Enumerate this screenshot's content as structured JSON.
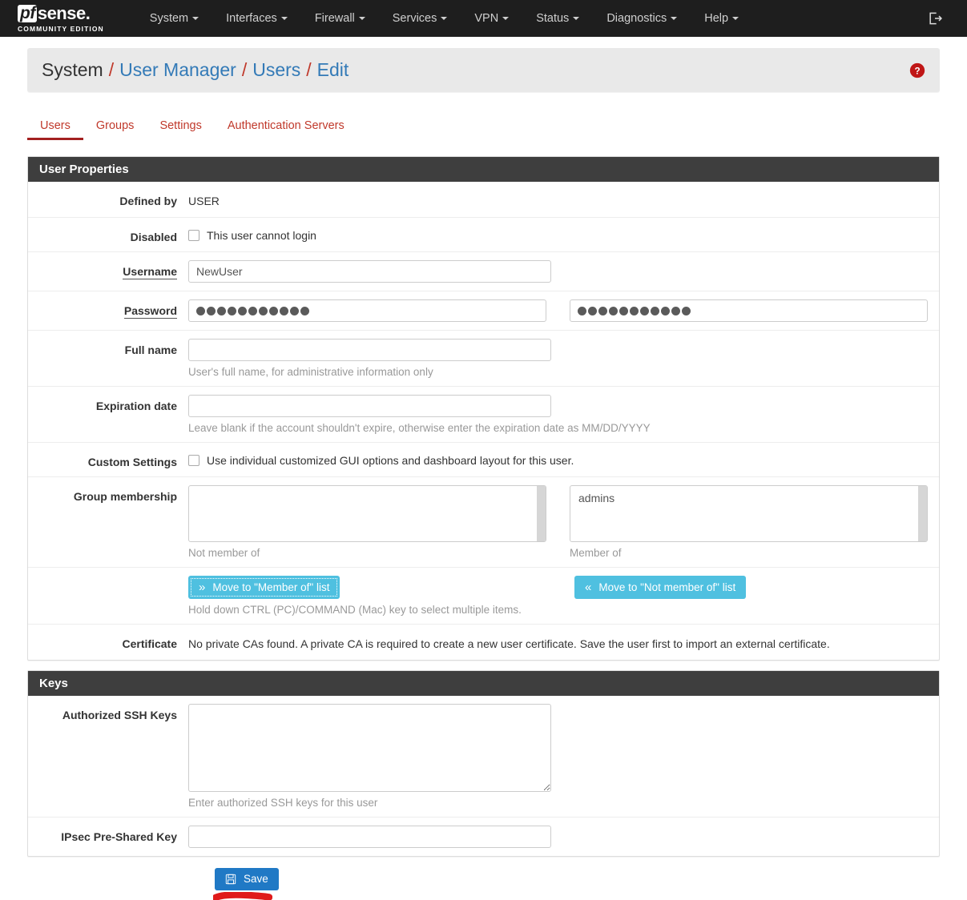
{
  "brand": {
    "name_pf": "pf",
    "name_sense": "sense",
    "subtitle": "COMMUNITY EDITION"
  },
  "navbar": {
    "items": [
      {
        "label": "System",
        "has_caret": true
      },
      {
        "label": "Interfaces",
        "has_caret": true
      },
      {
        "label": "Firewall",
        "has_caret": true
      },
      {
        "label": "Services",
        "has_caret": true
      },
      {
        "label": "VPN",
        "has_caret": true
      },
      {
        "label": "Status",
        "has_caret": true
      },
      {
        "label": "Diagnostics",
        "has_caret": true
      },
      {
        "label": "Help",
        "has_caret": true
      }
    ],
    "logout_icon": "logout-icon"
  },
  "breadcrumb": {
    "parts": [
      "System",
      "User Manager",
      "Users",
      "Edit"
    ],
    "separator": "/",
    "help_icon": "help-circle-icon"
  },
  "tabs": [
    {
      "label": "Users",
      "active": true
    },
    {
      "label": "Groups",
      "active": false
    },
    {
      "label": "Settings",
      "active": false
    },
    {
      "label": "Authentication Servers",
      "active": false
    }
  ],
  "user_properties": {
    "heading": "User Properties",
    "defined_by": {
      "label": "Defined by",
      "value": "USER"
    },
    "disabled": {
      "label": "Disabled",
      "checkbox_label": "This user cannot login",
      "checked": false
    },
    "username": {
      "label": "Username",
      "value": "NewUser",
      "placeholder": "",
      "required": true
    },
    "password": {
      "label": "Password",
      "required": true,
      "value_masked": "•••••••••••",
      "confirm_masked": "•••••••••••",
      "dot_count": 11
    },
    "full_name": {
      "label": "Full name",
      "value": "",
      "placeholder": "",
      "help": "User's full name, for administrative information only"
    },
    "expiration_date": {
      "label": "Expiration date",
      "value": "",
      "placeholder": "",
      "help": "Leave blank if the account shouldn't expire, otherwise enter the expiration date as MM/DD/YYYY"
    },
    "custom_settings": {
      "label": "Custom Settings",
      "checkbox_label": "Use individual customized GUI options and dashboard layout for this user.",
      "checked": false
    },
    "group_membership": {
      "label": "Group membership",
      "not_member_of": {
        "caption": "Not member of",
        "options": []
      },
      "member_of": {
        "caption": "Member of",
        "options": [
          "admins"
        ]
      },
      "move_to_member_button": "Move to \"Member of\" list",
      "move_to_not_member_button": "Move to \"Not member of\" list",
      "help": "Hold down CTRL (PC)/COMMAND (Mac) key to select multiple items."
    },
    "certificate": {
      "label": "Certificate",
      "value": "No private CAs found. A private CA is required to create a new user certificate. Save the user first to import an external certificate."
    }
  },
  "keys": {
    "heading": "Keys",
    "authorized_ssh_keys": {
      "label": "Authorized SSH Keys",
      "value": "",
      "placeholder": "",
      "help": "Enter authorized SSH keys for this user"
    },
    "ipsec_psk": {
      "label": "IPsec Pre-Shared Key",
      "value": "",
      "placeholder": ""
    }
  },
  "actions": {
    "save_label": "Save",
    "save_icon": "floppy-disk-icon"
  },
  "colors": {
    "navbar_bg": "#1e1e1e",
    "panel_heading_bg": "#3e3e3e",
    "tab_active": "#a32020",
    "tab_text": "#c0392b",
    "link": "#337ab7",
    "btn_info": "#4fc0e0",
    "btn_primary": "#2079c5",
    "annotation_red": "#e01b1b"
  }
}
